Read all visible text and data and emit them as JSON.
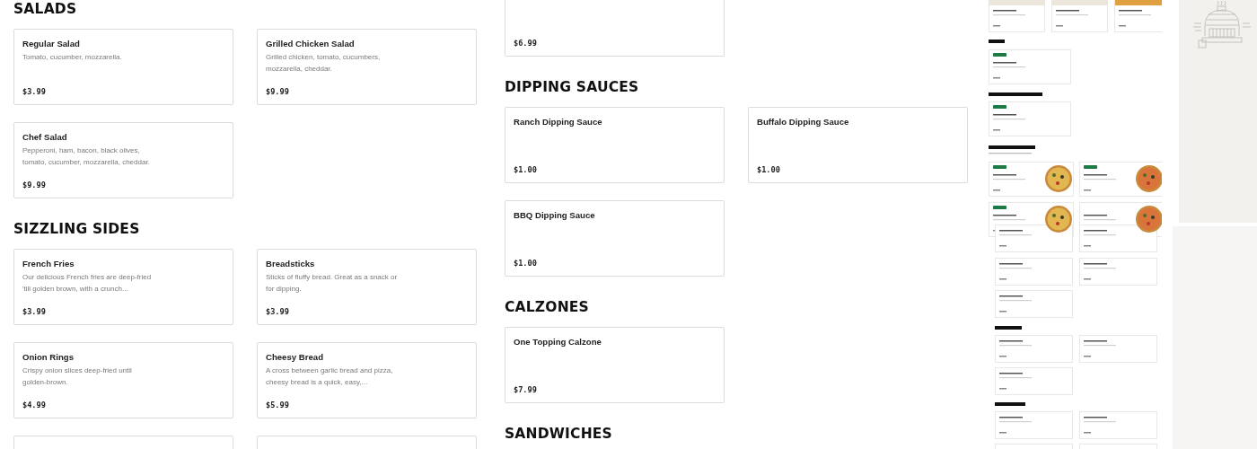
{
  "columns": [
    {
      "sections": [
        {
          "heading": "SALADS",
          "items": [
            {
              "kind": "full",
              "name": "Regular Salad",
              "description": "Tomato, cucumber, mozzarella.",
              "price": "$3.99"
            },
            {
              "kind": "full",
              "name": "Grilled Chicken Salad",
              "description": "Grilled chicken, tomato, cucumbers, mozzarella, cheddar.",
              "price": "$9.99"
            },
            {
              "kind": "full",
              "name": "Chef Salad",
              "description": "Pepperoni, ham, bacon, black olives, tomato, cucumber, mozzarella, cheddar.",
              "price": "$9.99"
            }
          ]
        },
        {
          "heading": "SIZZLING SIDES",
          "items": [
            {
              "kind": "full",
              "name": "French Fries",
              "description": "Our delicious French fries are deep-fried 'till golden brown, with a crunch...",
              "price": "$3.99"
            },
            {
              "kind": "full",
              "name": "Breadsticks",
              "description": "Sticks of fluffy bread. Great as a snack or for dipping.",
              "price": "$3.99"
            },
            {
              "kind": "full",
              "name": "Onion Rings",
              "description": "Crispy onion slices deep-fried until golden-brown.",
              "price": "$4.99"
            },
            {
              "kind": "full",
              "name": "Cheesy Bread",
              "description": "A cross between garlic bread and pizza, cheesy bread is a quick, easy,...",
              "price": "$5.99"
            },
            {
              "kind": "full"
            },
            {
              "kind": "full"
            }
          ]
        }
      ]
    },
    {
      "sections": [
        {
          "items": [
            {
              "kind": "partial",
              "price": "$6.99"
            }
          ]
        },
        {
          "heading": "DIPPING SAUCES",
          "items": [
            {
              "kind": "full",
              "name": "Ranch Dipping Sauce",
              "price": "$1.00"
            },
            {
              "kind": "full",
              "name": "Buffalo Dipping Sauce",
              "price": "$1.00"
            },
            {
              "kind": "full",
              "name": "BBQ Dipping Sauce",
              "price": "$1.00"
            }
          ]
        },
        {
          "heading": "CALZONES",
          "items": [
            {
              "kind": "full",
              "name": "One Topping Calzone",
              "price": "$7.99"
            }
          ]
        },
        {
          "heading": "SANDWICHES"
        }
      ]
    }
  ]
}
